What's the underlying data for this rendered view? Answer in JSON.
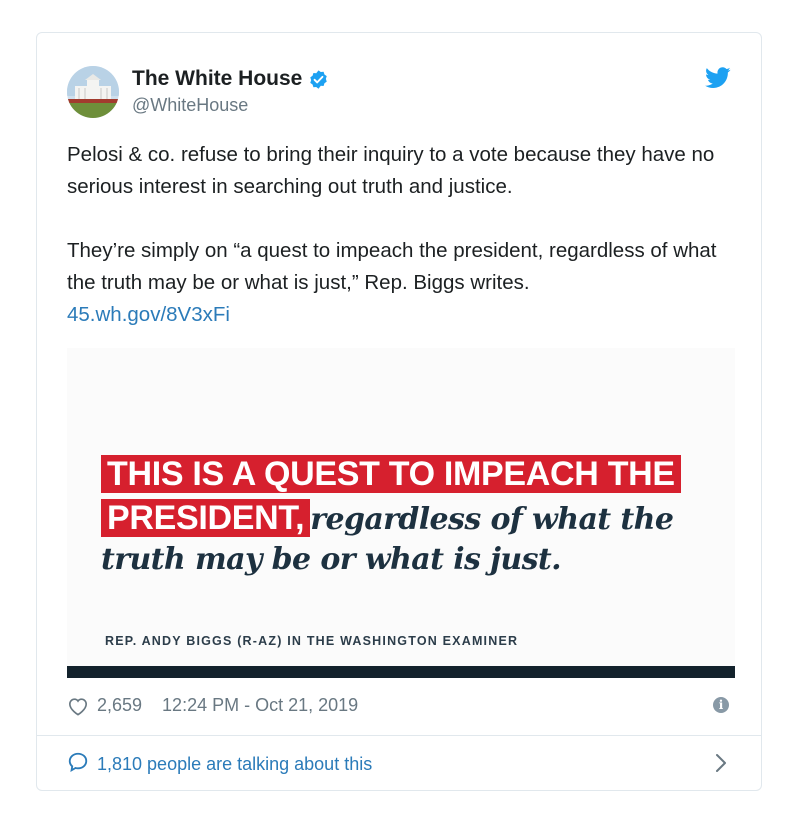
{
  "tweet": {
    "author_name": "The White House",
    "author_handle": "@WhiteHouse",
    "paragraph_1": "Pelosi & co. refuse to bring their inquiry to a vote because they have no serious interest in searching out truth and justice.",
    "paragraph_2": "They’re simply on “a quest to impeach the president, regardless of what the truth may be or what is just,” Rep. Biggs writes.",
    "link": "45.wh.gov/8V3xFi",
    "likes": "2,659",
    "timestamp": "12:24 PM - Oct 21, 2019",
    "talking": "1,810 people are talking about this"
  },
  "media": {
    "headline_line1": "THIS IS A QUEST TO IMPEACH THE",
    "headline_line2_highlight": "PRESIDENT,",
    "headline_line2_rest": "regardless of what the",
    "headline_line3": "truth may be or what is just.",
    "attribution": "REP. ANDY BIGGS (R-AZ) IN THE WASHINGTON EXAMINER"
  },
  "colors": {
    "link": "#2b7bb9",
    "highlight": "#d6202e",
    "navy": "#1d3140",
    "twitter_blue": "#1da1f2"
  },
  "icons": {
    "verified": "verified-badge-icon",
    "bird": "twitter-bird-icon",
    "heart": "heart-icon",
    "info": "info-icon",
    "comment": "comment-bubble-icon",
    "chevron": "chevron-right-icon"
  }
}
